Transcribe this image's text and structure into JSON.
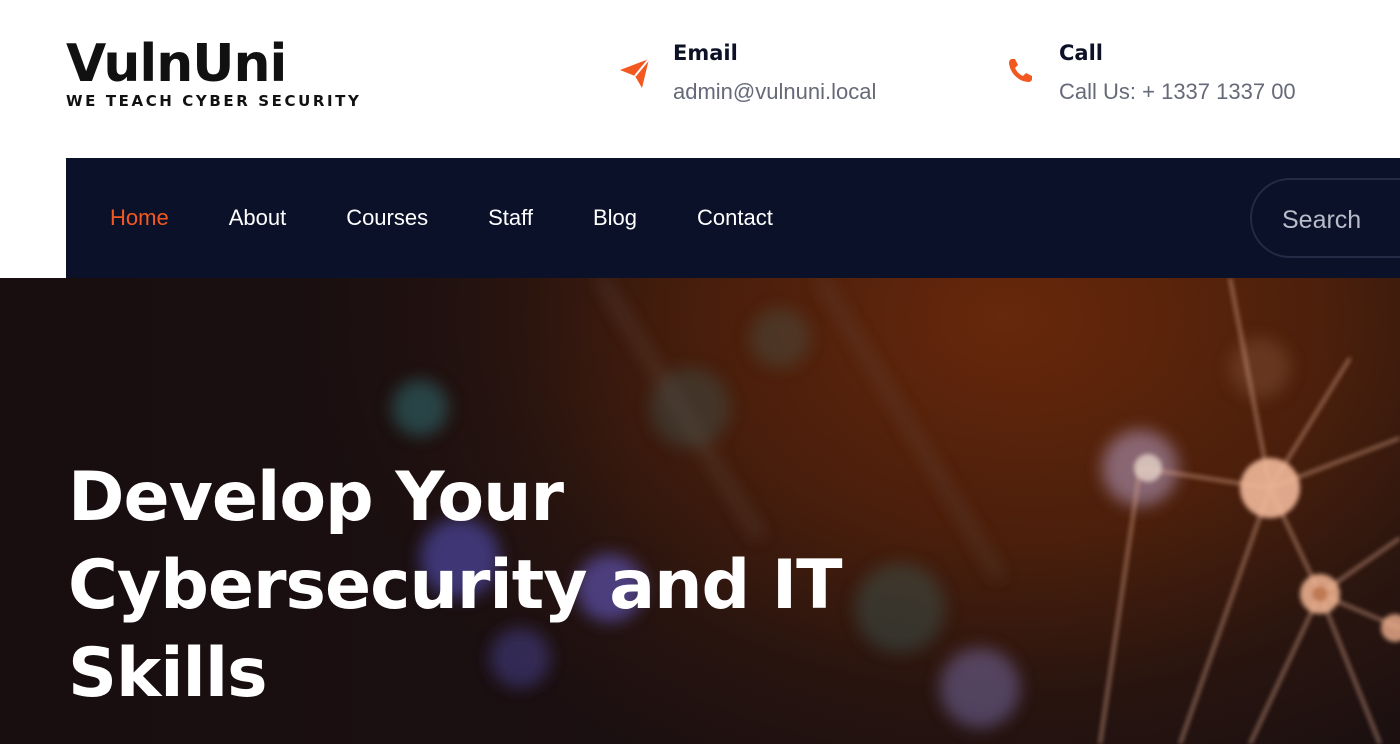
{
  "brand": {
    "name": "VulnUni",
    "tagline": "WE TEACH CYBER SECURITY"
  },
  "contact": {
    "email": {
      "title": "Email",
      "value": "admin@vulnuni.local",
      "icon": "paper-plane-icon"
    },
    "call": {
      "title": "Call",
      "value": "Call Us: + 1337 1337 00",
      "icon": "phone-icon"
    }
  },
  "nav": {
    "items": [
      {
        "label": "Home",
        "active": true
      },
      {
        "label": "About",
        "active": false
      },
      {
        "label": "Courses",
        "active": false
      },
      {
        "label": "Staff",
        "active": false
      },
      {
        "label": "Blog",
        "active": false
      },
      {
        "label": "Contact",
        "active": false
      }
    ],
    "search_placeholder": "Search"
  },
  "hero": {
    "title_lines": [
      "Develop Your",
      "Cybersecurity and IT",
      "Skills"
    ]
  },
  "colors": {
    "accent": "#f2581f",
    "nav_bg": "#0c112a",
    "text_dark": "#111111",
    "text_muted": "#666a78"
  }
}
